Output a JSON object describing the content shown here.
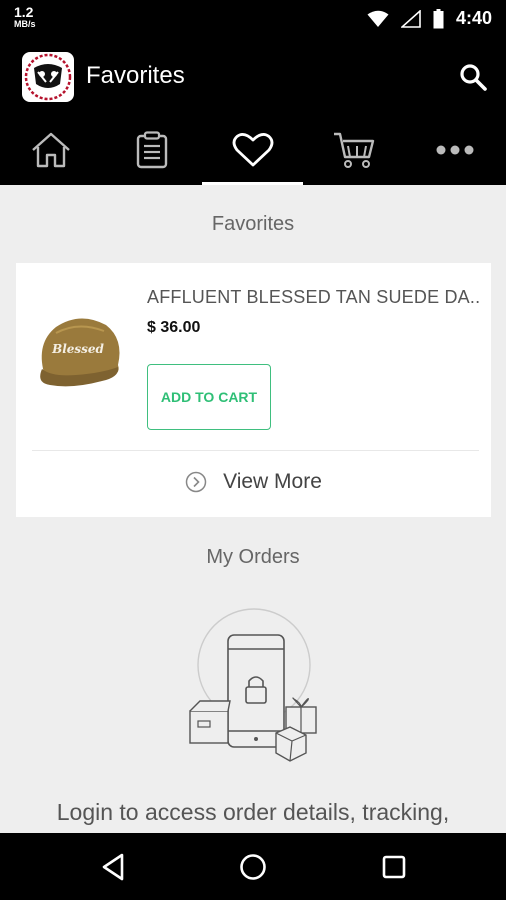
{
  "status_bar": {
    "net_speed": "1.2",
    "net_unit": "MB/s",
    "time": "4:40"
  },
  "app_bar": {
    "title": "Favorites",
    "logo_icon": "app-logo",
    "search_icon": "search-icon"
  },
  "tabs": [
    {
      "name": "home",
      "icon": "home-icon"
    },
    {
      "name": "orders",
      "icon": "clipboard-icon"
    },
    {
      "name": "favorites",
      "icon": "heart-icon",
      "active": true
    },
    {
      "name": "cart",
      "icon": "cart-icon"
    },
    {
      "name": "more",
      "icon": "more-icon"
    }
  ],
  "favorites": {
    "title": "Favorites",
    "item": {
      "name": "AFFLUENT BLESSED TAN SUEDE DA...",
      "price": "$ 36.00",
      "add_label": "ADD TO CART",
      "cap_text": "Blessed"
    },
    "view_more": "View More"
  },
  "orders": {
    "title": "My Orders",
    "message": "Login to access order details, tracking,"
  },
  "colors": {
    "accent": "#2fbf76",
    "background": "#eeeeee",
    "bar": "#000000"
  }
}
